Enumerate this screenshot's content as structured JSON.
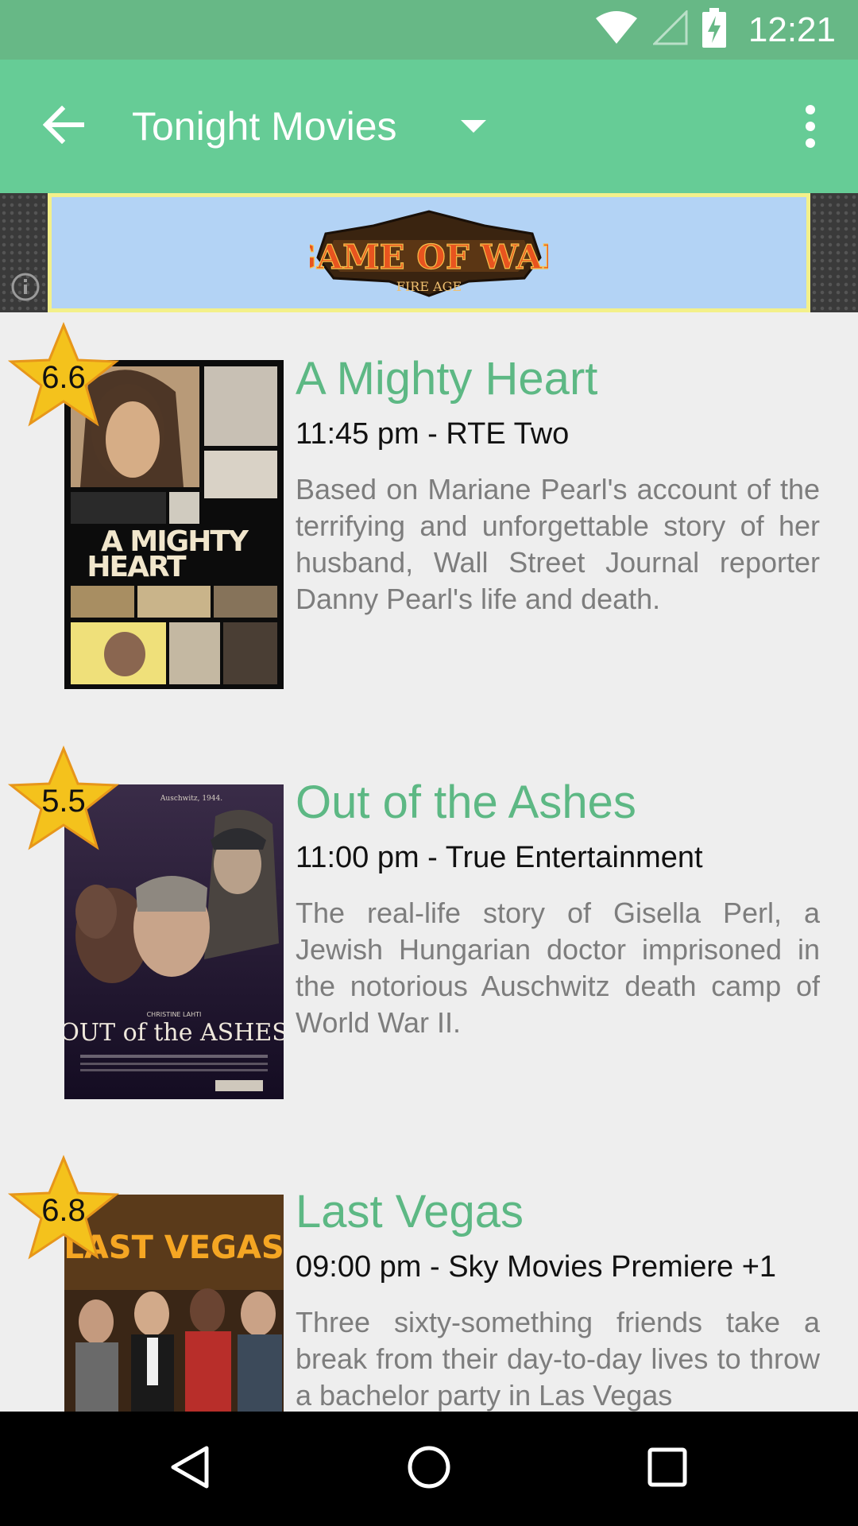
{
  "status_bar": {
    "time": "12:21",
    "icons": [
      "wifi-icon",
      "cell-signal-icon",
      "battery-charging-icon"
    ]
  },
  "app_bar": {
    "title": "Tonight Movies",
    "icons": [
      "back-arrow-icon",
      "dropdown-caret-icon",
      "overflow-menu-icon"
    ],
    "color": "#66cc96"
  },
  "ad": {
    "logo_text": "GAME OF WAR",
    "logo_subtext": "FIRE AGE"
  },
  "movies": [
    {
      "rating": "6.6",
      "title": "A Mighty Heart",
      "time_channel": "11:45 pm - RTE Two",
      "description": "Based on Mariane Pearl's account of the terrifying and unforgettable story of her husband, Wall Street Journal reporter Danny Pearl's life and death.",
      "poster_text": "A MIGHTY HEART"
    },
    {
      "rating": "5.5",
      "title": "Out of the Ashes",
      "time_channel": "11:00 pm - True Entertainment",
      "description": "The real-life story of Gisella Perl, a Jewish Hungarian doctor imprisoned in the notorious Auschwitz death camp of World War II.",
      "poster_text": "OUT OF THE ASHES"
    },
    {
      "rating": "6.8",
      "title": "Last Vegas",
      "time_channel": "09:00 pm - Sky Movies Premiere +1",
      "description": "Three sixty-something friends take a break from their day-to-day lives to throw a bachelor party in Las Vegas",
      "poster_text": "LAST VEGAS"
    }
  ],
  "nav_bar": {
    "icons": [
      "back-triangle-icon",
      "home-circle-icon",
      "recents-square-icon"
    ]
  },
  "colors": {
    "accent": "#5db884",
    "status_bar": "#67b886",
    "star": "#f5c518"
  }
}
